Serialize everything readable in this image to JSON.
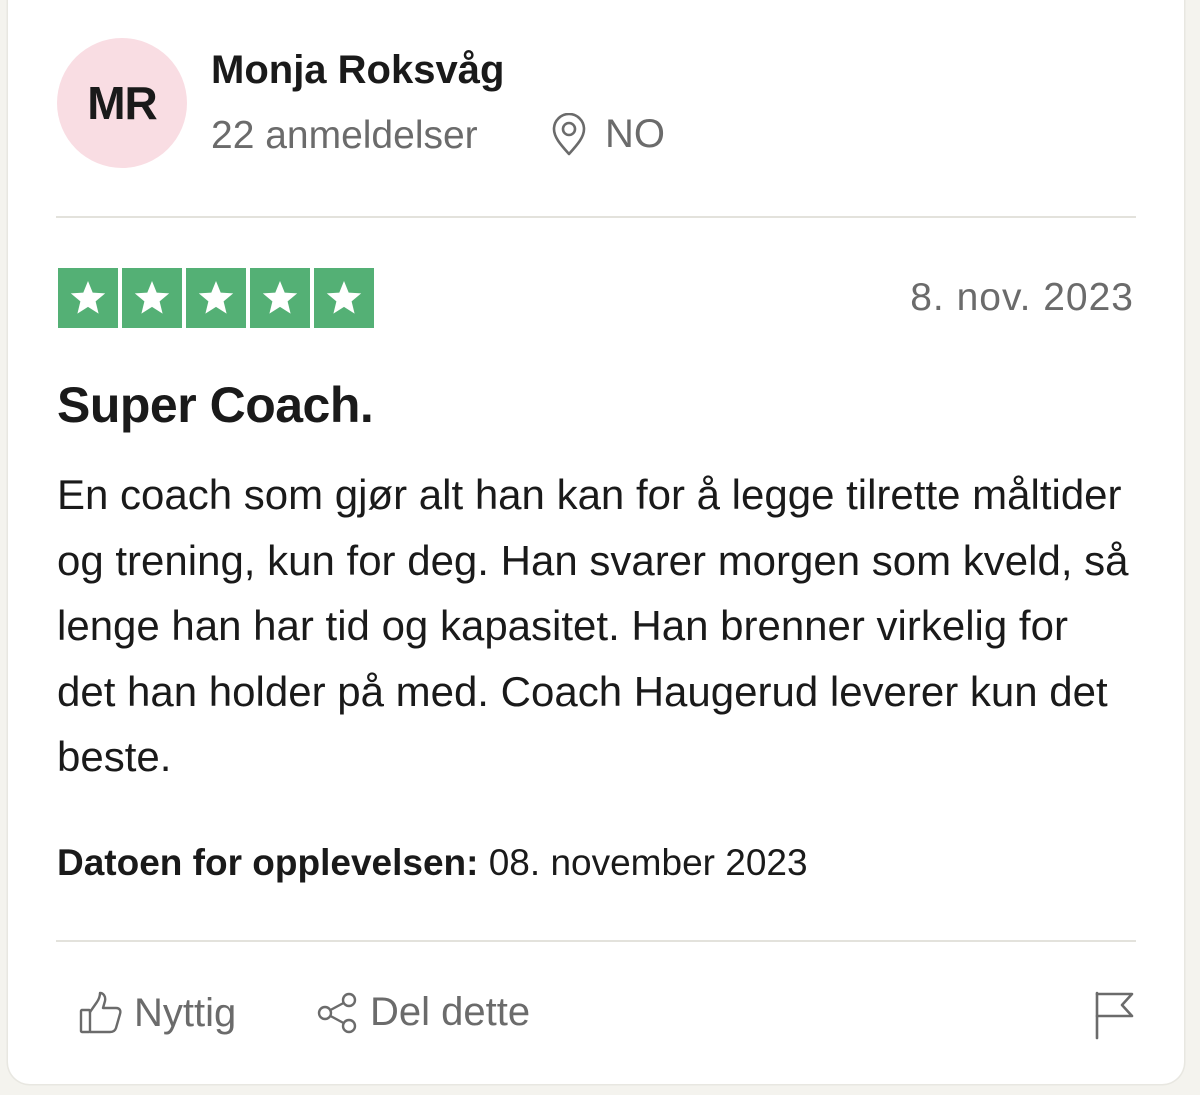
{
  "reviewer": {
    "initials": "MR",
    "name": "Monja Roksvåg",
    "review_count": "22 anmeldelser",
    "country": "NO"
  },
  "review": {
    "rating": 5,
    "rating_max": 5,
    "date": "8. nov. 2023",
    "title": "Super Coach.",
    "body": "En coach som gjør alt han kan for å legge tilrette måltider og trening, kun for deg. Han svarer morgen som kveld, så lenge han har tid og kapasitet. Han brenner virkelig for det han holder på med. Coach Haugerud leverer kun det beste.",
    "experience_label": "Datoen for opplevelsen:",
    "experience_date": "08. november 2023"
  },
  "actions": {
    "useful_label": "Nyttig",
    "share_label": "Del dette"
  },
  "colors": {
    "star_green": "#54b075",
    "avatar_bg": "#f9dde3",
    "muted_text": "#6b6b6b",
    "divider": "#e3e2dc"
  },
  "icons": [
    "location-pin-icon",
    "star-icon",
    "thumbs-up-icon",
    "share-icon",
    "flag-icon"
  ]
}
